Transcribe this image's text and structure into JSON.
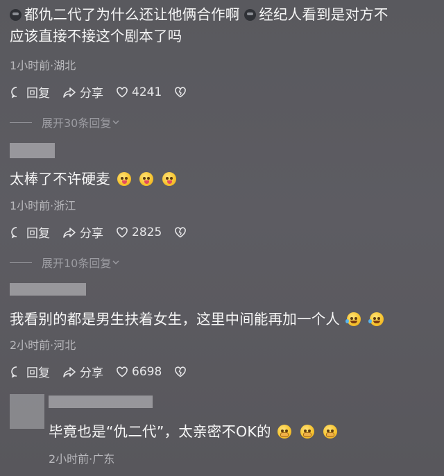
{
  "comments": [
    {
      "text_line1": "都仇二代了为什么还让他俩合作啊",
      "text_mid": "经纪人看到是对方不",
      "text_line2": "应该直接不接这个剧本了吗",
      "meta": "1小时前·湖北",
      "reply_label": "回复",
      "share_label": "分享",
      "likes": "4241",
      "expand_label": "展开30条回复"
    },
    {
      "text": "太棒了不许硬麦",
      "meta": "1小时前·浙江",
      "reply_label": "回复",
      "share_label": "分享",
      "likes": "2825",
      "expand_label": "展开10条回复"
    },
    {
      "text": "我看别的都是男生扶着女生，这里中间能再加一个人",
      "meta": "2小时前·河北",
      "reply_label": "回复",
      "share_label": "分享",
      "likes": "6698"
    },
    {
      "text": "毕竟也是“仇二代”，太亲密不OK的",
      "meta": "2小时前·广东"
    }
  ],
  "icons": {
    "reply": "comment-bubble-icon",
    "share": "share-arrow-icon",
    "like": "heart-icon",
    "dislike": "broken-heart-icon",
    "expand": "chevron-down-icon"
  }
}
